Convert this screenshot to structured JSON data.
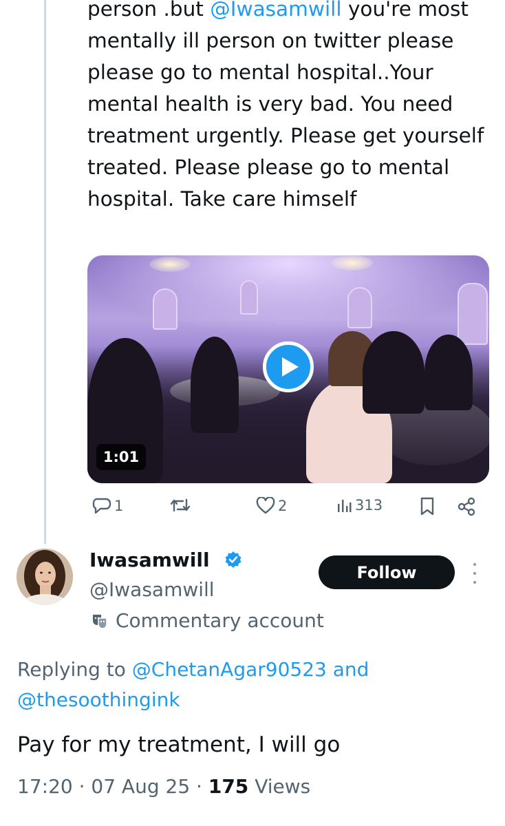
{
  "parent_tweet": {
    "text_segments": [
      {
        "text": "person .but ",
        "type": "text"
      },
      {
        "text": "@Iwasamwill",
        "type": "mention"
      },
      {
        "text": " you're most mentally ill person on twitter please please go to mental hospital..Your mental health is very bad. You need treatment urgently. Please get yourself treated. Please please go to mental hospital. Take care himself",
        "type": "text"
      }
    ],
    "video": {
      "duration": "1:01",
      "play_icon": "play-icon"
    },
    "actions": {
      "reply_count": "1",
      "retweet_count": "",
      "like_count": "2",
      "views_count": "313"
    }
  },
  "reply_tweet": {
    "author_name": "Iwasamwill",
    "handle": "@Iwasamwill",
    "account_label": "Commentary account",
    "follow_label": "Follow",
    "replying_prefix": "Replying to ",
    "replying_to_1": "@ChetanAgar90523",
    "replying_and": " and",
    "replying_to_2": "@thesoothingink",
    "text": "Pay for my treatment, I will go",
    "time": "17:20",
    "separator": " · ",
    "date": "07 Aug 25",
    "views_count": "175",
    "views_label": " Views"
  },
  "colors": {
    "accent": "#1d9bf0",
    "text_primary": "#0f1419",
    "text_secondary": "#536471",
    "thread_line": "#cfd9de"
  }
}
